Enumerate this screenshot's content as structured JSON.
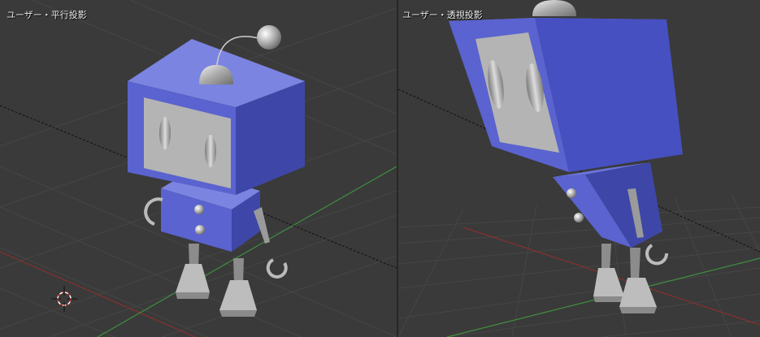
{
  "viewports": {
    "left": {
      "label": "ユーザー・平行投影"
    },
    "right": {
      "label": "ユーザー・透視投影"
    }
  },
  "colors": {
    "background": "#3a3a3a",
    "grid": "#444444",
    "x_axis": "#8a2f2f",
    "y_axis": "#3f8f3f",
    "robot_body": "#5660c8",
    "robot_face": "#b4b4b4"
  }
}
